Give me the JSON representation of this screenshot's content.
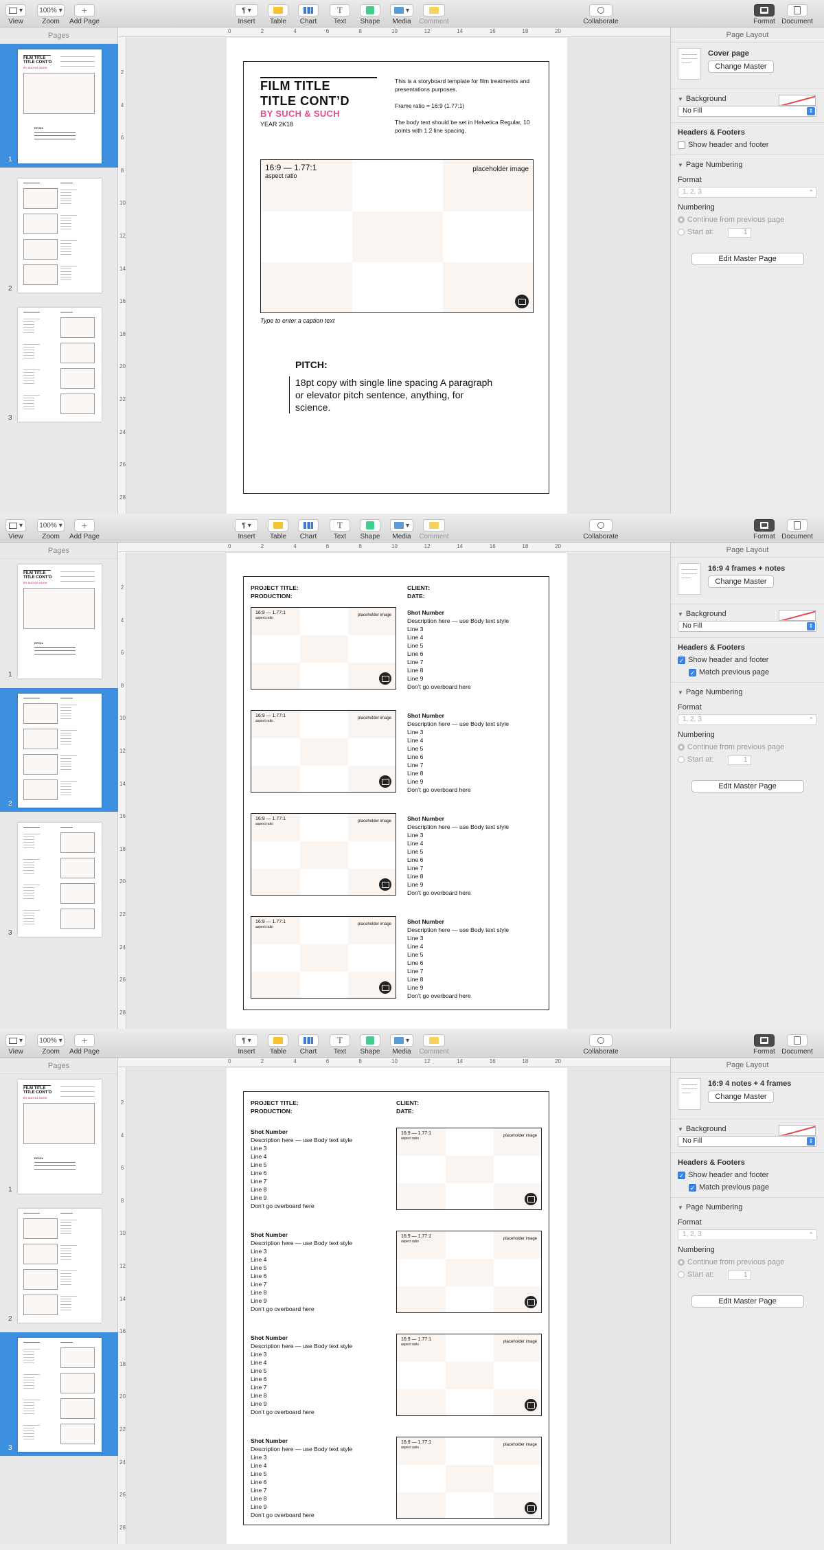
{
  "toolbar": {
    "view": "View",
    "zoom_value": "100%",
    "zoom": "Zoom",
    "add_page": "Add Page",
    "insert": "Insert",
    "table": "Table",
    "chart": "Chart",
    "text": "Text",
    "shape": "Shape",
    "media": "Media",
    "comment": "Comment",
    "collaborate": "Collaborate",
    "format": "Format",
    "document": "Document",
    "colors": {
      "table": "#f4c430",
      "chart": "#3a7bd5",
      "shape": "#3ecf8e",
      "comment": "#f6d35b"
    }
  },
  "sidebar": {
    "title": "Pages",
    "page_numbers": [
      "1",
      "2",
      "3"
    ]
  },
  "ruler": {
    "h_ticks": [
      "0",
      "2",
      "4",
      "6",
      "8",
      "10",
      "12",
      "14",
      "16",
      "18",
      "20"
    ],
    "v_ticks": [
      "2",
      "4",
      "6",
      "8",
      "10",
      "12",
      "14",
      "16",
      "18",
      "20",
      "22",
      "24",
      "26",
      "28"
    ]
  },
  "inspector": {
    "header": "Page Layout",
    "background": "Background",
    "fill": "No Fill",
    "headers_footers": "Headers & Footers",
    "show_header_footer": "Show header and footer",
    "match_previous": "Match previous page",
    "page_numbering": "Page Numbering",
    "format": "Format",
    "format_value": "1, 2, 3",
    "numbering": "Numbering",
    "continue_prev": "Continue from previous page",
    "start_at": "Start at:",
    "start_value": "1",
    "edit_master": "Edit Master Page",
    "change_master": "Change Master",
    "accent": "#3b86e6"
  },
  "windows": [
    {
      "master_name": "Cover page",
      "show_header": false,
      "match_prev": false,
      "selected_page": 1
    },
    {
      "master_name": "16:9 4 frames + notes",
      "show_header": true,
      "match_prev": true,
      "selected_page": 2
    },
    {
      "master_name": "16:9 4 notes + 4 frames",
      "show_header": true,
      "match_prev": true,
      "selected_page": 3
    }
  ],
  "cover": {
    "title1": "FILM TITLE",
    "title2": "TITLE CONT’D",
    "byline": "BY SUCH & SUCH",
    "year": "YEAR 2K18",
    "body1": "This is a storyboard template for film treatments and presentations purposes.",
    "body2": "Frame ratio = 16:9 (1.77:1)",
    "body3": "The body text should be set in Helvetica Regular, 10 points with 1.2 line spacing.",
    "caption": "Type to enter a caption text",
    "pitch_title": "PITCH:",
    "pitch_body": "18pt copy with single line spacing A paragraph or elevator pitch sentence, anything, for science."
  },
  "frame": {
    "ratio": "16:9 — 1.77:1",
    "aspect": "aspect ratio",
    "placeholder": "placeholder image"
  },
  "storyboard": {
    "project_title": "PROJECT TITLE:",
    "production": "PRODUCTION:",
    "client": "CLIENT:",
    "date": "DATE:",
    "shot_number": "Shot Number",
    "description": "Description here — use Body text style",
    "lines": [
      "Line 3",
      "Line 4",
      "Line 5",
      "Line 6",
      "Line 7",
      "Line 8",
      "Line 9"
    ],
    "overboard": "Don’t go overboard here"
  }
}
